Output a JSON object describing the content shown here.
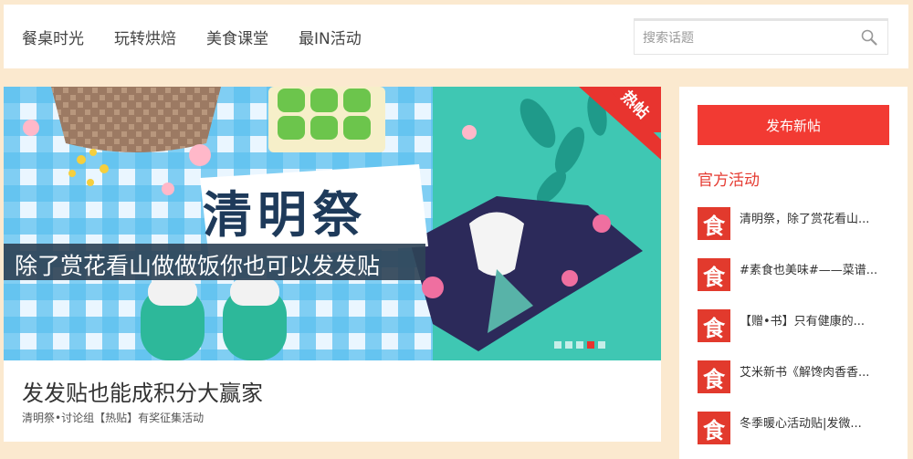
{
  "nav": {
    "items": [
      "餐桌时光",
      "玩转烘焙",
      "美食课堂",
      "最IN活动"
    ]
  },
  "search": {
    "placeholder": "搜索话题",
    "icon": "search-icon"
  },
  "banner": {
    "title": "清明祭",
    "subtitle": "除了赏花看山做做饭你也可以发发贴",
    "corner_tag": "热帖",
    "slide_count": 5,
    "active_slide": 3
  },
  "post": {
    "title": "发发贴也能成积分大赢家",
    "meta": "清明祭•讨论组【热贴】有奖征集活动"
  },
  "sidebar": {
    "publish_label": "发布新帖",
    "section_title": "官方活动",
    "activities": [
      {
        "thumb": "食",
        "text": "清明祭，除了赏花看山..."
      },
      {
        "thumb": "食",
        "text": "#素食也美味#——菜谱..."
      },
      {
        "thumb": "食",
        "text": "【赠•书】只有健康的..."
      },
      {
        "thumb": "食",
        "text": "艾米新书《解馋肉香香..."
      },
      {
        "thumb": "食",
        "text": "冬季暖心活动贴|发微..."
      }
    ]
  },
  "colors": {
    "page_bg": "#fbe9cf",
    "accent_red": "#f23a33",
    "banner_teal": "#3fc7b3"
  }
}
